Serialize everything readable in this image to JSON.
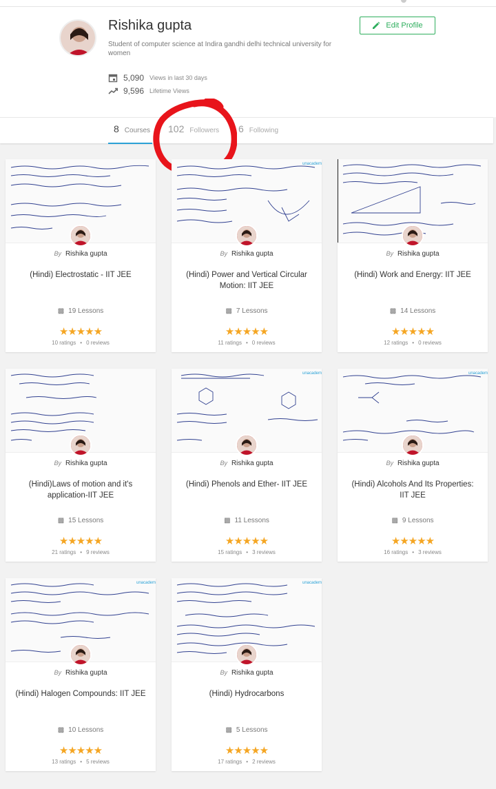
{
  "profile": {
    "name": "Rishika gupta",
    "bio": "Student of computer science at Indira gandhi delhi technical university for women",
    "edit_label": "Edit Profile",
    "views_30_value": "5,090",
    "views_30_label": "Views in last 30 days",
    "lifetime_value": "9,596",
    "lifetime_label": "Lifetime Views"
  },
  "tabs": [
    {
      "count": "8",
      "label": "Courses"
    },
    {
      "count": "102",
      "label": "Followers"
    },
    {
      "count": "6",
      "label": "Following"
    }
  ],
  "brand_badge": "unacademy",
  "by_label": "By",
  "colors": {
    "accent": "#2eae5d",
    "tab_underline": "#2aa1d6",
    "star": "#f5a623",
    "annotation": "#e8141b"
  },
  "courses": [
    {
      "author": "Rishika gupta",
      "title": "(Hindi) Electrostatic - IIT JEE",
      "lessons": "19 Lessons",
      "ratings": "10 ratings",
      "reviews": "0 reviews",
      "stars": "★★★★★"
    },
    {
      "author": "Rishika gupta",
      "title": "(Hindi) Power and Vertical Circular Motion: IIT JEE",
      "lessons": "7 Lessons",
      "ratings": "11 ratings",
      "reviews": "0 reviews",
      "stars": "★★★★★"
    },
    {
      "author": "Rishika gupta",
      "title": "(Hindi) Work and Energy: IIT JEE",
      "lessons": "14 Lessons",
      "ratings": "12 ratings",
      "reviews": "0 reviews",
      "stars": "★★★★★"
    },
    {
      "author": "Rishika gupta",
      "title": "(Hindi)Laws of motion and it's application-IIT JEE",
      "lessons": "15 Lessons",
      "ratings": "21 ratings",
      "reviews": "9 reviews",
      "stars": "★★★★★"
    },
    {
      "author": "Rishika gupta",
      "title": "(Hindi) Phenols and Ether- IIT JEE",
      "lessons": "11 Lessons",
      "ratings": "15 ratings",
      "reviews": "3 reviews",
      "stars": "★★★★★"
    },
    {
      "author": "Rishika gupta",
      "title": "(Hindi) Alcohols And Its Properties: IIT JEE",
      "lessons": "9 Lessons",
      "ratings": "16 ratings",
      "reviews": "3 reviews",
      "stars": "★★★★★"
    },
    {
      "author": "Rishika gupta",
      "title": "(Hindi) Halogen Compounds: IIT JEE",
      "lessons": "10 Lessons",
      "ratings": "13 ratings",
      "reviews": "5 reviews",
      "stars": "★★★★★"
    },
    {
      "author": "Rishika gupta",
      "title": "(Hindi) Hydrocarbons",
      "lessons": "5 Lessons",
      "ratings": "17 ratings",
      "reviews": "2 reviews",
      "stars": "★★★★★"
    }
  ]
}
